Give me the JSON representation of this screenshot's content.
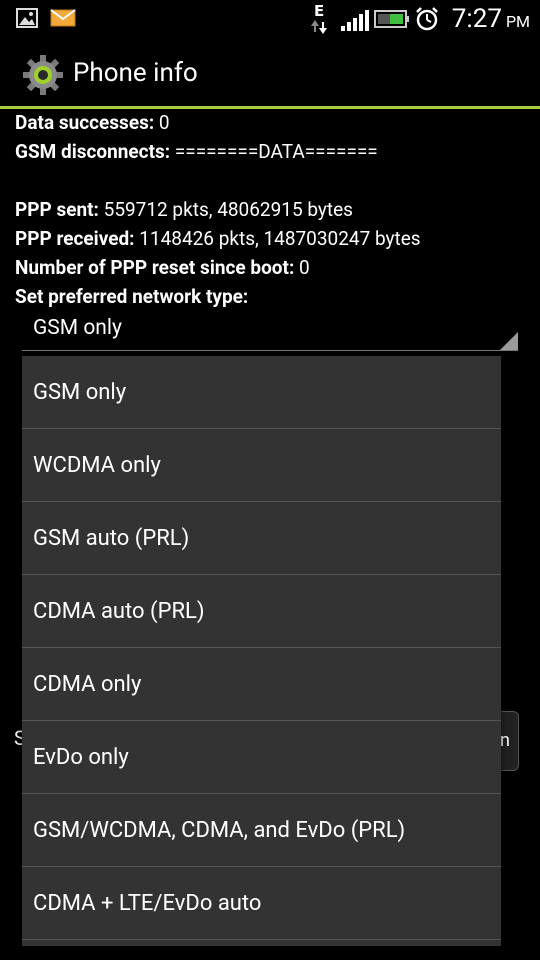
{
  "status_bar": {
    "time": "7:27",
    "ampm": "PM",
    "icons": [
      "gallery-icon",
      "message-icon",
      "data-e-icon",
      "signal-icon",
      "battery-icon",
      "alarm-icon"
    ],
    "network_letter": "E"
  },
  "title_bar": {
    "title": "Phone info",
    "icon": "gear-icon",
    "accent_color": "#a4cc3b"
  },
  "info_rows": [
    {
      "label": "Data successes:",
      "value": "0"
    },
    {
      "label": "GSM disconnects:",
      "value": "========DATA======="
    },
    {
      "label": "PPP sent:",
      "value": "559712 pkts, 48062915 bytes"
    },
    {
      "label": "PPP received:",
      "value": "1148426 pkts, 1487030247 bytes"
    },
    {
      "label": "Number of PPP reset since boot:",
      "value": "0"
    },
    {
      "label": "Set preferred network type:",
      "value": ""
    }
  ],
  "network_spinner": {
    "selected": "GSM only"
  },
  "behind_text": {
    "left_char": "S",
    "button_partial": "n"
  },
  "dropdown_options": [
    "GSM only",
    "WCDMA only",
    "GSM auto (PRL)",
    "CDMA auto (PRL)",
    "CDMA only",
    "EvDo only",
    "GSM/WCDMA, CDMA, and EvDo (PRL)",
    "CDMA + LTE/EvDo auto"
  ]
}
